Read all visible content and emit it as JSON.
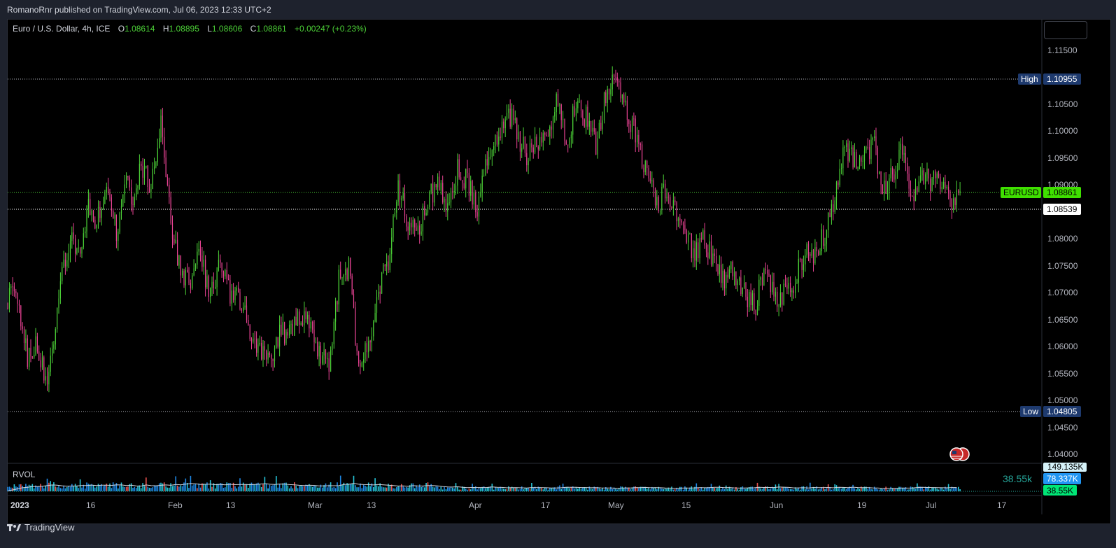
{
  "header": {
    "publisher": "RomanoRnr published on TradingView.com, Jul 06, 2023 12:33 UTC+2"
  },
  "legend": {
    "symbol": "Euro / U.S. Dollar, 4h, ICE",
    "open_label": "O",
    "open": "1.08614",
    "high_label": "H",
    "high": "1.08895",
    "low_label": "L",
    "low": "1.08606",
    "close_label": "C",
    "close": "1.08861",
    "change": "+0.00247 (+0.23%)"
  },
  "price_axis": {
    "ticks": [
      "1.11500",
      "1.10500",
      "1.10000",
      "1.09500",
      "1.09000",
      "1.08000",
      "1.07500",
      "1.07000",
      "1.06500",
      "1.06000",
      "1.05500",
      "1.05000",
      "1.04500",
      "1.04000"
    ],
    "high": {
      "label": "High",
      "value": "1.10955"
    },
    "low": {
      "label": "Low",
      "value": "1.04805"
    },
    "current": {
      "label": "EURUSD",
      "value": "1.08861"
    },
    "cursor": {
      "value": "1.08539"
    }
  },
  "time_axis": {
    "labels": [
      "2023",
      "16",
      "Feb",
      "13",
      "Mar",
      "13",
      "Apr",
      "17",
      "May",
      "15",
      "Jun",
      "19",
      "Jul",
      "17"
    ]
  },
  "rvol": {
    "label": "RVOL",
    "current_text": "38.55k",
    "axis_values": [
      "149.135K",
      "78.337K",
      "38.55K"
    ]
  },
  "chart_data": {
    "type": "candlestick",
    "title": "Euro / U.S. Dollar, 4h, ICE",
    "ylim": [
      1.0375,
      1.119
    ],
    "x_labels": [
      "2023",
      "16",
      "Feb",
      "13",
      "Mar",
      "13",
      "Apr",
      "17",
      "May",
      "15",
      "Jun",
      "19",
      "Jul",
      "17"
    ],
    "series": [
      {
        "name": "EURUSD",
        "close_path": [
          {
            "x": "2023-01-02",
            "y": 1.066
          },
          {
            "x": "2023-01-03",
            "y": 1.072
          },
          {
            "x": "2023-01-05",
            "y": 1.063
          },
          {
            "x": "2023-01-06",
            "y": 1.056
          },
          {
            "x": "2023-01-08",
            "y": 1.06
          },
          {
            "x": "2023-01-10",
            "y": 1.052
          },
          {
            "x": "2023-01-12",
            "y": 1.066
          },
          {
            "x": "2023-01-13",
            "y": 1.074
          },
          {
            "x": "2023-01-15",
            "y": 1.078
          },
          {
            "x": "2023-01-17",
            "y": 1.077
          },
          {
            "x": "2023-01-18",
            "y": 1.085
          },
          {
            "x": "2023-01-20",
            "y": 1.082
          },
          {
            "x": "2023-01-22",
            "y": 1.087
          },
          {
            "x": "2023-01-24",
            "y": 1.08
          },
          {
            "x": "2023-01-26",
            "y": 1.089
          },
          {
            "x": "2023-01-27",
            "y": 1.086
          },
          {
            "x": "2023-01-29",
            "y": 1.092
          },
          {
            "x": "2023-01-31",
            "y": 1.088
          },
          {
            "x": "2023-02-02",
            "y": 1.101
          },
          {
            "x": "2023-02-04",
            "y": 1.082
          },
          {
            "x": "2023-02-06",
            "y": 1.073
          },
          {
            "x": "2023-02-08",
            "y": 1.071
          },
          {
            "x": "2023-02-10",
            "y": 1.076
          },
          {
            "x": "2023-02-12",
            "y": 1.068
          },
          {
            "x": "2023-02-14",
            "y": 1.074
          },
          {
            "x": "2023-02-16",
            "y": 1.068
          },
          {
            "x": "2023-02-18",
            "y": 1.068
          },
          {
            "x": "2023-02-20",
            "y": 1.062
          },
          {
            "x": "2023-02-22",
            "y": 1.059
          },
          {
            "x": "2023-02-24",
            "y": 1.057
          },
          {
            "x": "2023-02-26",
            "y": 1.061
          },
          {
            "x": "2023-02-28",
            "y": 1.062
          },
          {
            "x": "2023-03-02",
            "y": 1.064
          },
          {
            "x": "2023-03-04",
            "y": 1.064
          },
          {
            "x": "2023-03-06",
            "y": 1.057
          },
          {
            "x": "2023-03-08",
            "y": 1.056
          },
          {
            "x": "2023-03-10",
            "y": 1.071
          },
          {
            "x": "2023-03-12",
            "y": 1.074
          },
          {
            "x": "2023-03-14",
            "y": 1.054
          },
          {
            "x": "2023-03-16",
            "y": 1.059
          },
          {
            "x": "2023-03-18",
            "y": 1.069
          },
          {
            "x": "2023-03-20",
            "y": 1.075
          },
          {
            "x": "2023-03-22",
            "y": 1.089
          },
          {
            "x": "2023-03-24",
            "y": 1.082
          },
          {
            "x": "2023-03-26",
            "y": 1.08
          },
          {
            "x": "2023-03-28",
            "y": 1.085
          },
          {
            "x": "2023-03-30",
            "y": 1.09
          },
          {
            "x": "2023-04-01",
            "y": 1.084
          },
          {
            "x": "2023-04-03",
            "y": 1.092
          },
          {
            "x": "2023-04-05",
            "y": 1.089
          },
          {
            "x": "2023-04-07",
            "y": 1.085
          },
          {
            "x": "2023-04-09",
            "y": 1.093
          },
          {
            "x": "2023-04-11",
            "y": 1.097
          },
          {
            "x": "2023-04-13",
            "y": 1.103
          },
          {
            "x": "2023-04-15",
            "y": 1.098
          },
          {
            "x": "2023-04-17",
            "y": 1.094
          },
          {
            "x": "2023-04-19",
            "y": 1.097
          },
          {
            "x": "2023-04-21",
            "y": 1.096
          },
          {
            "x": "2023-04-23",
            "y": 1.104
          },
          {
            "x": "2023-04-25",
            "y": 1.097
          },
          {
            "x": "2023-04-27",
            "y": 1.103
          },
          {
            "x": "2023-04-29",
            "y": 1.101
          },
          {
            "x": "2023-05-01",
            "y": 1.096
          },
          {
            "x": "2023-05-03",
            "y": 1.105
          },
          {
            "x": "2023-05-05",
            "y": 1.109
          },
          {
            "x": "2023-05-07",
            "y": 1.102
          },
          {
            "x": "2023-05-09",
            "y": 1.098
          },
          {
            "x": "2023-05-11",
            "y": 1.092
          },
          {
            "x": "2023-05-13",
            "y": 1.085
          },
          {
            "x": "2023-05-15",
            "y": 1.087
          },
          {
            "x": "2023-05-17",
            "y": 1.085
          },
          {
            "x": "2023-05-19",
            "y": 1.08
          },
          {
            "x": "2023-05-21",
            "y": 1.076
          },
          {
            "x": "2023-05-23",
            "y": 1.079
          },
          {
            "x": "2023-05-25",
            "y": 1.074
          },
          {
            "x": "2023-05-27",
            "y": 1.071
          },
          {
            "x": "2023-05-29",
            "y": 1.073
          },
          {
            "x": "2023-05-31",
            "y": 1.069
          },
          {
            "x": "2023-06-02",
            "y": 1.066
          },
          {
            "x": "2023-06-04",
            "y": 1.072
          },
          {
            "x": "2023-06-06",
            "y": 1.068
          },
          {
            "x": "2023-06-08",
            "y": 1.069
          },
          {
            "x": "2023-06-10",
            "y": 1.071
          },
          {
            "x": "2023-06-12",
            "y": 1.076
          },
          {
            "x": "2023-06-14",
            "y": 1.075
          },
          {
            "x": "2023-06-16",
            "y": 1.079
          },
          {
            "x": "2023-06-18",
            "y": 1.084
          },
          {
            "x": "2023-06-20",
            "y": 1.095
          },
          {
            "x": "2023-06-22",
            "y": 1.093
          },
          {
            "x": "2023-06-24",
            "y": 1.092
          },
          {
            "x": "2023-06-26",
            "y": 1.097
          },
          {
            "x": "2023-06-28",
            "y": 1.088
          },
          {
            "x": "2023-06-30",
            "y": 1.091
          },
          {
            "x": "2023-07-02",
            "y": 1.095
          },
          {
            "x": "2023-07-04",
            "y": 1.087
          },
          {
            "x": "2023-07-06",
            "y": 1.091
          },
          {
            "x": "2023-07-08",
            "y": 1.089
          },
          {
            "x": "2023-07-10",
            "y": 1.09
          },
          {
            "x": "2023-07-12",
            "y": 1.086
          },
          {
            "x": "2023-07-14",
            "y": 1.0886
          }
        ]
      }
    ],
    "colors": {
      "up": "#4cd137",
      "down": "#e84393",
      "background": "#000000"
    }
  }
}
